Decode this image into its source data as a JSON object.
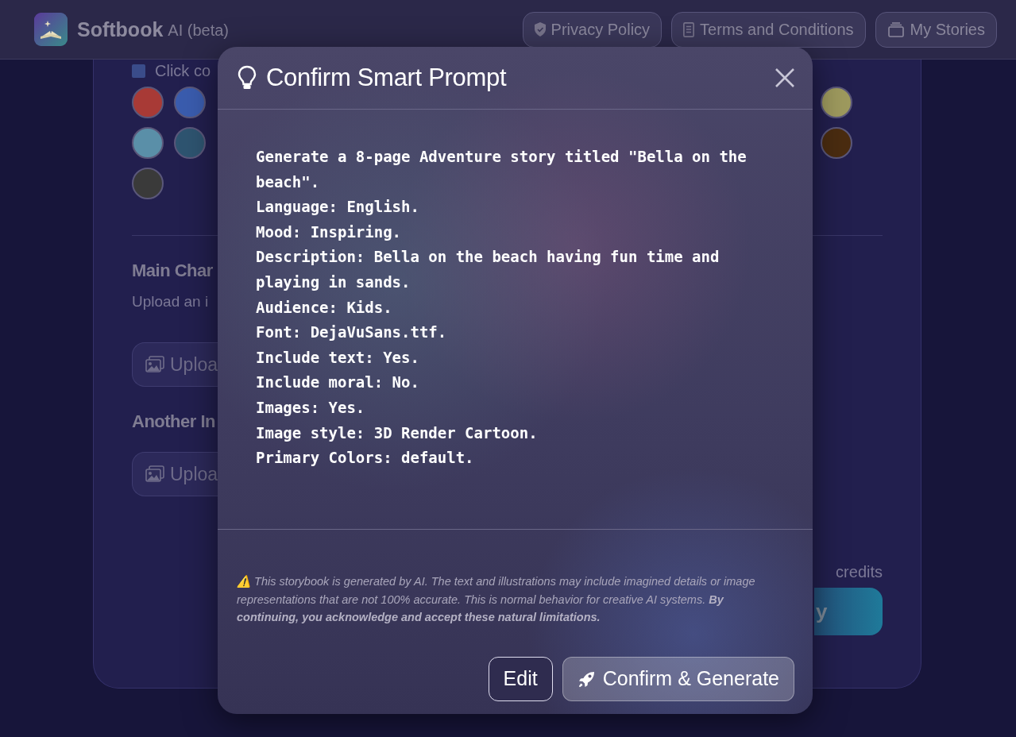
{
  "header": {
    "brand": "Softbook",
    "brand_suffix": "AI (beta)",
    "links": [
      {
        "label": "Privacy Policy",
        "kind": "privacy"
      },
      {
        "label": "Terms and Conditions",
        "kind": "terms"
      },
      {
        "label": "My Stories",
        "kind": "stories"
      }
    ]
  },
  "form": {
    "hint": "Click co",
    "swatch_rows": [
      {
        "left": [
          {
            "color": "#a83a36"
          },
          {
            "color": "#3a5cae"
          }
        ],
        "right": [
          {
            "color": "#9e9a5e"
          }
        ]
      },
      {
        "left": [
          {
            "color": "#5a8fa8"
          },
          {
            "color": "#2e5470"
          }
        ],
        "right": [
          {
            "color": "#4a2c10"
          }
        ]
      },
      {
        "left": [
          {
            "color": "#3a3a3a"
          }
        ],
        "right": []
      }
    ],
    "sections": [
      {
        "heading": "Main Char",
        "description": "Upload an i",
        "upload_button": "Uploa"
      },
      {
        "heading": "Another In",
        "upload_button": "Uploa"
      }
    ],
    "credits": "credits",
    "generate_button": "y"
  },
  "modal": {
    "title": "Confirm Smart Prompt",
    "prompt_lines": [
      "Generate a 8-page Adventure story titled \"Bella on the beach\".",
      "Language: English.",
      "Mood: Inspiring.",
      "Description: Bella on the beach having fun time and playing in sands.",
      "Audience: Kids.",
      "Font: DejaVuSans.ttf.",
      "Include text: Yes.",
      "Include moral: No.",
      "Images: Yes.",
      "Image style: 3D Render Cartoon.",
      "Primary Colors: default."
    ],
    "disclaimer": "⚠️ This storybook is generated by AI. The text and illustrations may include imagined details or image representations that are not 100% accurate. This is normal behavior for creative AI systems. **By continuing, you acknowledge and accept these natural limitations.**",
    "buttons": [
      {
        "label": "Edit",
        "kind": "secondary"
      },
      {
        "label": "Confirm & Generate",
        "kind": "primary"
      }
    ]
  }
}
